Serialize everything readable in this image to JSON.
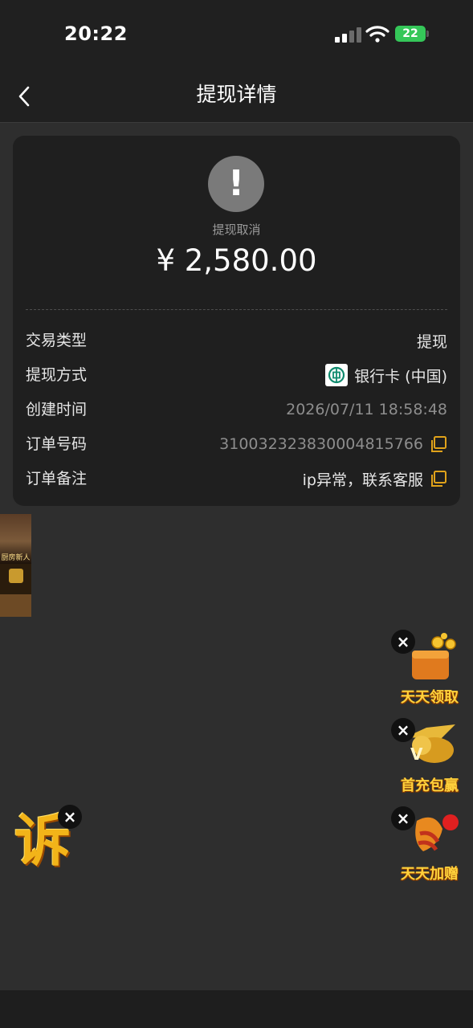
{
  "status_bar": {
    "time": "20:22",
    "signal_icon": "cellular-signal-icon",
    "wifi_icon": "wifi-icon",
    "battery": "22",
    "battery_color": "#35c759"
  },
  "nav": {
    "back_icon": "chevron-left-icon",
    "title": "提现详情"
  },
  "summary": {
    "status_icon": "exclamation-circle-icon",
    "status_text": "提现取消",
    "amount": "¥ 2,580.00"
  },
  "details": [
    {
      "label": "交易类型",
      "value": "提现"
    },
    {
      "label": "提现方式",
      "value": "银行卡 (中国)",
      "icon": "bank-of-china-logo"
    },
    {
      "label": "创建时间",
      "value": "2026/07/11 18:58:48"
    },
    {
      "label": "订单号码",
      "value": "310032323830004815766",
      "action_icon": "copy-icon"
    },
    {
      "label": "订单备注",
      "value": "ip异常，联系客服",
      "action_icon": "copy-icon"
    }
  ],
  "ads": {
    "left_banner": {
      "text": "厨房新人",
      "icon": "promo-banner-icon"
    },
    "daily_claim": {
      "caption": "天天领取",
      "icon": "coin-wallet-icon"
    },
    "first_deposit": {
      "caption": "首充包赢",
      "icon": "lion-emblem-icon"
    },
    "daily_bonus": {
      "caption": "天天加赠",
      "icon": "gift-bonus-icon"
    },
    "complaint": {
      "glyph": "诉",
      "icon": "complaint-icon"
    },
    "close_icon": "close-icon",
    "accent_color": "#ffd23c"
  }
}
